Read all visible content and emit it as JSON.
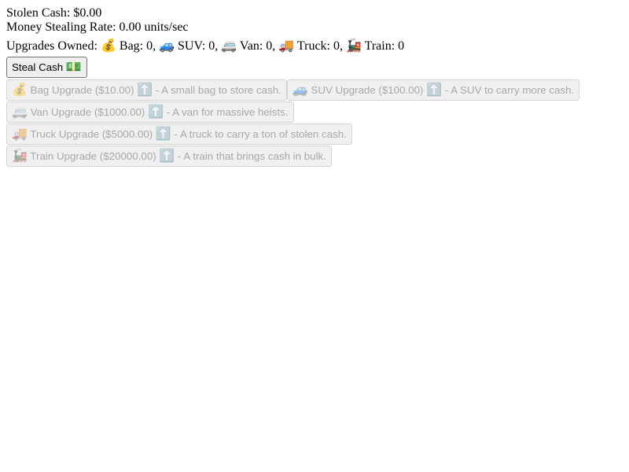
{
  "stats": {
    "stolen_cash_label": "Stolen Cash: ",
    "stolen_cash_value": "$0.00",
    "rate_label": "Money Stealing Rate: ",
    "rate_value": "0.00 units/sec"
  },
  "owned": {
    "label": "Upgrades Owned: ",
    "items": [
      {
        "icon": "💰",
        "text": " Bag: 0, "
      },
      {
        "icon": "🚙",
        "text": " SUV: 0, "
      },
      {
        "icon": "🚐",
        "text": " Van: 0, "
      },
      {
        "icon": "🚚",
        "text": " Truck: 0, "
      },
      {
        "icon": "🚂",
        "text": " Train: 0"
      }
    ]
  },
  "steal_button": {
    "label": "Steal Cash ",
    "icon": "💵"
  },
  "upgrades": [
    {
      "icon": "💰",
      "name": " Bag Upgrade ($10.00) ",
      "arrow": "⬆️",
      "desc": " - A small bag to store cash."
    },
    {
      "icon": "🚙",
      "name": " SUV Upgrade ($100.00) ",
      "arrow": "⬆️",
      "desc": " - A SUV to carry more cash."
    },
    {
      "icon": "🚐",
      "name": " Van Upgrade ($1000.00) ",
      "arrow": "⬆️",
      "desc": " - A van for massive heists."
    },
    {
      "icon": "🚚",
      "name": " Truck Upgrade ($5000.00) ",
      "arrow": "⬆️",
      "desc": " - A truck to carry a ton of stolen cash."
    },
    {
      "icon": "🚂",
      "name": " Train Upgrade ($20000.00) ",
      "arrow": "⬆️",
      "desc": " - A train that brings cash in bulk."
    }
  ]
}
